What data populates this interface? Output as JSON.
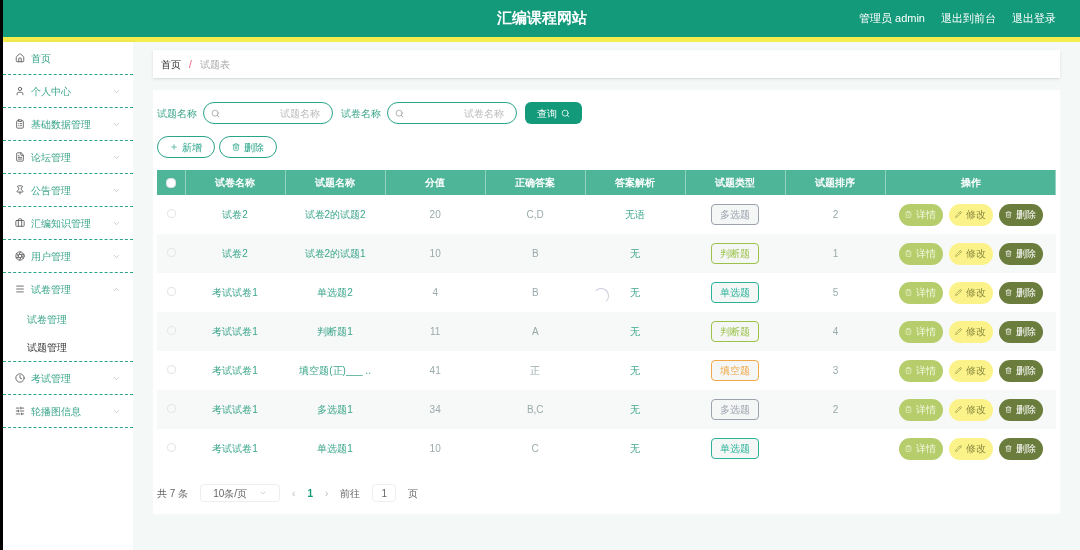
{
  "header": {
    "title": "汇编课程网站",
    "links": [
      "管理员 admin",
      "退出到前台",
      "退出登录"
    ]
  },
  "sidebar": {
    "items": [
      {
        "label": "首页"
      },
      {
        "label": "个人中心",
        "expanded": false
      },
      {
        "label": "基础数据管理",
        "expanded": false
      },
      {
        "label": "论坛管理",
        "expanded": false
      },
      {
        "label": "公告管理",
        "expanded": false
      },
      {
        "label": "汇编知识管理",
        "expanded": false
      },
      {
        "label": "用户管理",
        "expanded": false
      },
      {
        "label": "试卷管理",
        "expanded": true,
        "children": [
          {
            "label": "试卷管理",
            "selected": false
          },
          {
            "label": "试题管理",
            "selected": true
          }
        ]
      },
      {
        "label": "考试管理",
        "expanded": false
      },
      {
        "label": "轮播图信息",
        "expanded": false
      }
    ]
  },
  "breadcrumb": {
    "items": [
      "首页",
      "试题表"
    ],
    "separator": "/"
  },
  "search": {
    "fields": [
      {
        "label": "试题名称",
        "placeholder": "试题名称"
      },
      {
        "label": "试卷名称",
        "placeholder": "试卷名称"
      }
    ],
    "button": "查询"
  },
  "actions": [
    "新增",
    "删除"
  ],
  "table": {
    "all_checked": false,
    "columns": [
      "试卷名称",
      "试题名称",
      "分值",
      "正确答案",
      "答案解析",
      "试题类型",
      "试题排序",
      "操作"
    ],
    "rows": [
      {
        "checked": false,
        "paper": "试卷2",
        "question": "试卷2的试题2",
        "score": "20",
        "answer": "C,D",
        "analysis": "无语",
        "type": "多选题",
        "color": "#9ca3af",
        "order": "2",
        "buttons": [
          "详情",
          "修改",
          "删除"
        ]
      },
      {
        "checked": false,
        "paper": "试卷2",
        "question": "试卷2的试题1",
        "score": "10",
        "answer": "B",
        "analysis": "无",
        "type": "判断题",
        "color": "#9cc24a",
        "order": "1",
        "buttons": [
          "详情",
          "修改",
          "删除"
        ]
      },
      {
        "checked": false,
        "paper": "考试试卷1",
        "question": "单选题2",
        "score": "4",
        "answer": "B",
        "analysis": "无",
        "type": "单选题",
        "color": "#2bb39a",
        "order": "5",
        "buttons": [
          "详情",
          "修改",
          "删除"
        ]
      },
      {
        "checked": false,
        "paper": "考试试卷1",
        "question": "判断题1",
        "score": "11",
        "answer": "A",
        "analysis": "无",
        "type": "判断题",
        "color": "#9cc24a",
        "order": "4",
        "buttons": [
          "详情",
          "修改",
          "删除"
        ]
      },
      {
        "checked": false,
        "paper": "考试试卷1",
        "question": "填空题(正)___ ..",
        "score": "41",
        "answer": "正",
        "analysis": "无",
        "type": "填空题",
        "color": "#f0a848",
        "order": "3",
        "buttons": [
          "详情",
          "修改",
          "删除"
        ]
      },
      {
        "checked": false,
        "paper": "考试试卷1",
        "question": "多选题1",
        "score": "34",
        "answer": "B,C",
        "analysis": "无",
        "type": "多选题",
        "color": "#9ca3af",
        "order": "2",
        "buttons": [
          "详情",
          "修改",
          "删除"
        ]
      },
      {
        "checked": false,
        "paper": "考试试卷1",
        "question": "单选题1",
        "score": "10",
        "answer": "C",
        "analysis": "无",
        "type": "单选题",
        "color": "#2bb39a",
        "buttons": [
          "详情",
          "修改",
          "删除"
        ]
      }
    ]
  },
  "pagination": {
    "total": "共 7 条",
    "page_size": "10条/页",
    "prev": "‹",
    "page": "1",
    "next": "›",
    "goto_label": "前往",
    "goto_value": "1",
    "goto_suffix": "页"
  }
}
